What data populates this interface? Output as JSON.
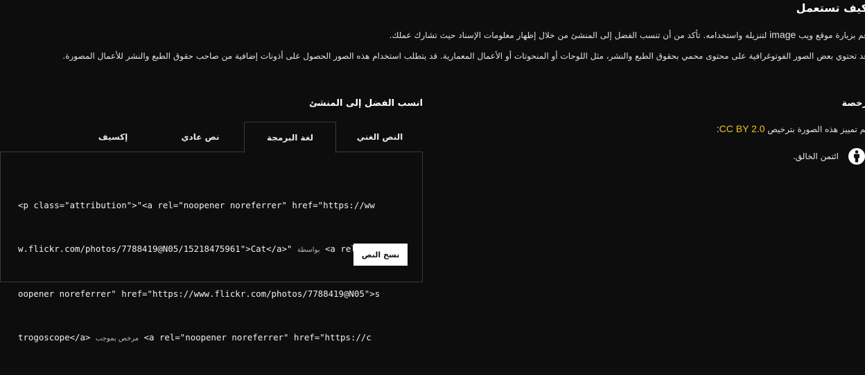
{
  "how_to_use": {
    "title": "كيف تستعمل",
    "paragraph1_before": "قم بزيارة موقع ويب",
    "paragraph1_site": "image",
    "paragraph1_after": "لتنزيله واستخدامه. تأكد من أن تنسب الفضل إلى المنشئ من خلال إظهار معلومات الإسناد حيث تشارك عملك.",
    "paragraph2": "قد تحتوي بعض الصور الفوتوغرافية على محتوى محمي بحقوق الطبع والنشر، مثل اللوحات أو المنحوتات أو الأعمال المعمارية. قد يتطلب استخدام هذه الصور الحصول على أذونات إضافية من صاحب حقوق الطبع والنشر للأعمال المصورة."
  },
  "attribution": {
    "title": "انسب الفضل إلى المنشئ",
    "tabs": [
      {
        "label": "النص الغني",
        "active": false
      },
      {
        "label": "لغة البرمجة",
        "active": true
      },
      {
        "label": "نص عادي",
        "active": false
      },
      {
        "label": "إكسيف",
        "active": false
      }
    ],
    "code_lines": [
      [
        "<p class=\"attribution\">\"<a rel=\"noopener noreferrer\" href=\"https://ww"
      ],
      [
        "w.flickr.com/photos/7788419@N05/15218475961\">Cat</a>\" ",
        "بواسطة",
        " <a rel=\"n"
      ],
      [
        "oopener noreferrer\" href=\"https://www.flickr.com/photos/7788419@N05\">s"
      ],
      [
        "trogoscope</a> ",
        "مرخص بموجب",
        " <a rel=\"noopener noreferrer\" href=\"https://c"
      ]
    ],
    "copy_button": "نسخ النص"
  },
  "license": {
    "title": "رخصة",
    "text": "تم تمييز هذه الصورة بترخيص",
    "link": "CC BY 2.0",
    "colon": ":",
    "by_text": "ائتمن الخالق.",
    "link_color": "#f0c419"
  }
}
